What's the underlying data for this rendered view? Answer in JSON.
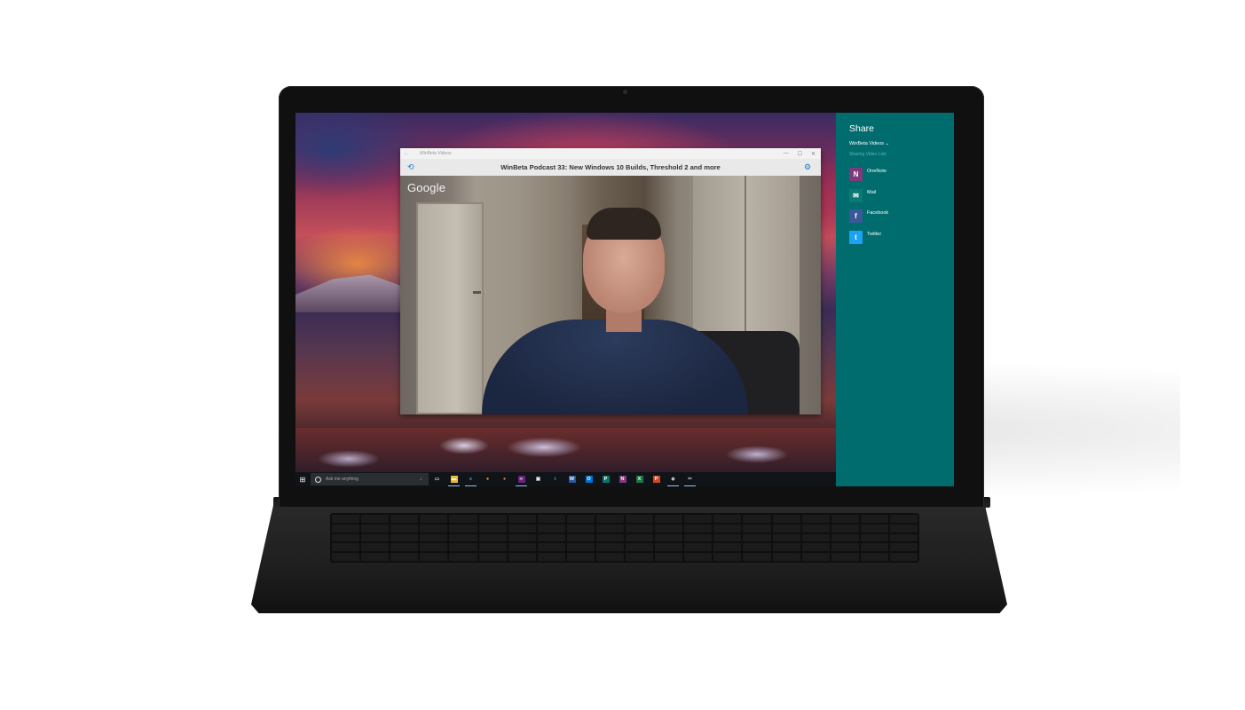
{
  "window": {
    "app_name": "WinBeta Videos",
    "back_glyph": "←",
    "minimize_glyph": "—",
    "maximize_glyph": "☐",
    "close_glyph": "✕"
  },
  "app_header": {
    "left_icon": "repeat-icon",
    "title": "WinBeta Podcast 33: New Windows 10 Builds, Threshold 2 and more",
    "right_icon": "settings-icon"
  },
  "video": {
    "watermark": "Google"
  },
  "share": {
    "title": "Share",
    "source_app": "WinBeta Videos ⌄",
    "subtitle": "Sharing Video Link",
    "targets": [
      {
        "label": "OneNote",
        "icon": "onenote-icon",
        "glyph": "N",
        "color": "#80397b"
      },
      {
        "label": "Mail",
        "icon": "mail-icon",
        "glyph": "✉",
        "color": "#0a7a73"
      },
      {
        "label": "Facebook",
        "icon": "facebook-icon",
        "glyph": "f",
        "color": "#3b5998"
      },
      {
        "label": "Twitter",
        "icon": "twitter-icon",
        "glyph": "t",
        "color": "#1da1f2"
      }
    ]
  },
  "taskbar": {
    "start_glyph": "⊞",
    "search_placeholder": "Ask me anything",
    "mic_glyph": "🎙",
    "apps": [
      {
        "name": "task-view-icon",
        "glyph": "▭",
        "color": "transparent",
        "active": false
      },
      {
        "name": "file-explorer-icon",
        "glyph": "▬",
        "color": "#e8b838",
        "active": true
      },
      {
        "name": "edge-icon",
        "glyph": "e",
        "color": "transparent",
        "active": true
      },
      {
        "name": "chrome-icon",
        "glyph": "●",
        "color": "transparent",
        "active": false
      },
      {
        "name": "firefox-icon",
        "glyph": "●",
        "color": "transparent",
        "active": false
      },
      {
        "name": "visual-studio-icon",
        "glyph": "∞",
        "color": "#68217a",
        "active": true
      },
      {
        "name": "store-icon",
        "glyph": "▣",
        "color": "transparent",
        "active": false
      },
      {
        "name": "twitter-app-icon",
        "glyph": "t",
        "color": "transparent",
        "active": false
      },
      {
        "name": "word-icon",
        "glyph": "W",
        "color": "#2b579a",
        "active": false
      },
      {
        "name": "outlook-icon",
        "glyph": "O",
        "color": "#0072c6",
        "active": false
      },
      {
        "name": "publisher-icon",
        "glyph": "P",
        "color": "#077568",
        "active": false
      },
      {
        "name": "onenote-app-icon",
        "glyph": "N",
        "color": "#80397b",
        "active": false
      },
      {
        "name": "excel-icon",
        "glyph": "X",
        "color": "#217346",
        "active": false
      },
      {
        "name": "powerpoint-icon",
        "glyph": "P",
        "color": "#d24726",
        "active": false
      },
      {
        "name": "winbeta-icon",
        "glyph": "◈",
        "color": "transparent",
        "active": true
      },
      {
        "name": "snipping-tool-icon",
        "glyph": "✂",
        "color": "transparent",
        "active": true
      }
    ]
  },
  "colors": {
    "share_pane_bg": "#006c6d",
    "taskbar_bg": "#101418",
    "accent": "#1e76c8"
  }
}
